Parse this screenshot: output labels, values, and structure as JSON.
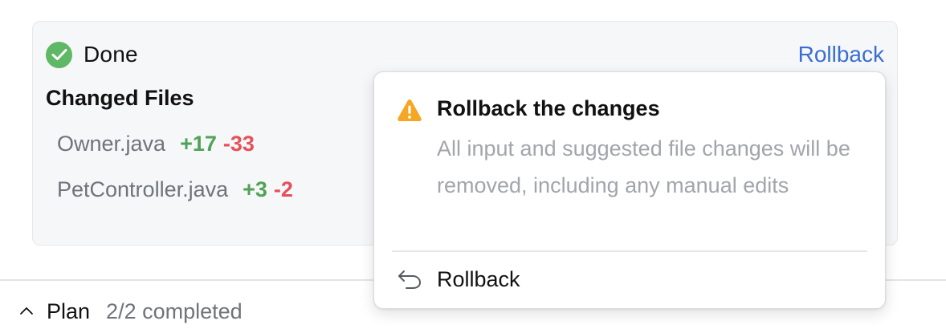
{
  "card": {
    "status_label": "Done",
    "rollback_link": "Rollback",
    "section_title": "Changed Files",
    "files": [
      {
        "name": "Owner.java",
        "added": "+17",
        "removed": "-33"
      },
      {
        "name": "PetController.java",
        "added": "+3",
        "removed": "-2"
      }
    ]
  },
  "plan": {
    "label": "Plan",
    "status": "2/2 completed"
  },
  "popup": {
    "title": "Rollback the changes",
    "description": "All input and suggested file changes will be removed, including any manual edits",
    "action_label": "Rollback"
  },
  "icons": {
    "status": "check-circle-icon",
    "warning": "warning-icon",
    "action": "undo-icon",
    "plan_toggle": "chevron-up-icon"
  },
  "colors": {
    "success": "#5fb865",
    "added": "#4fa354",
    "removed": "#e5505a",
    "link": "#3b6ed0",
    "warning": "#f5a623"
  }
}
